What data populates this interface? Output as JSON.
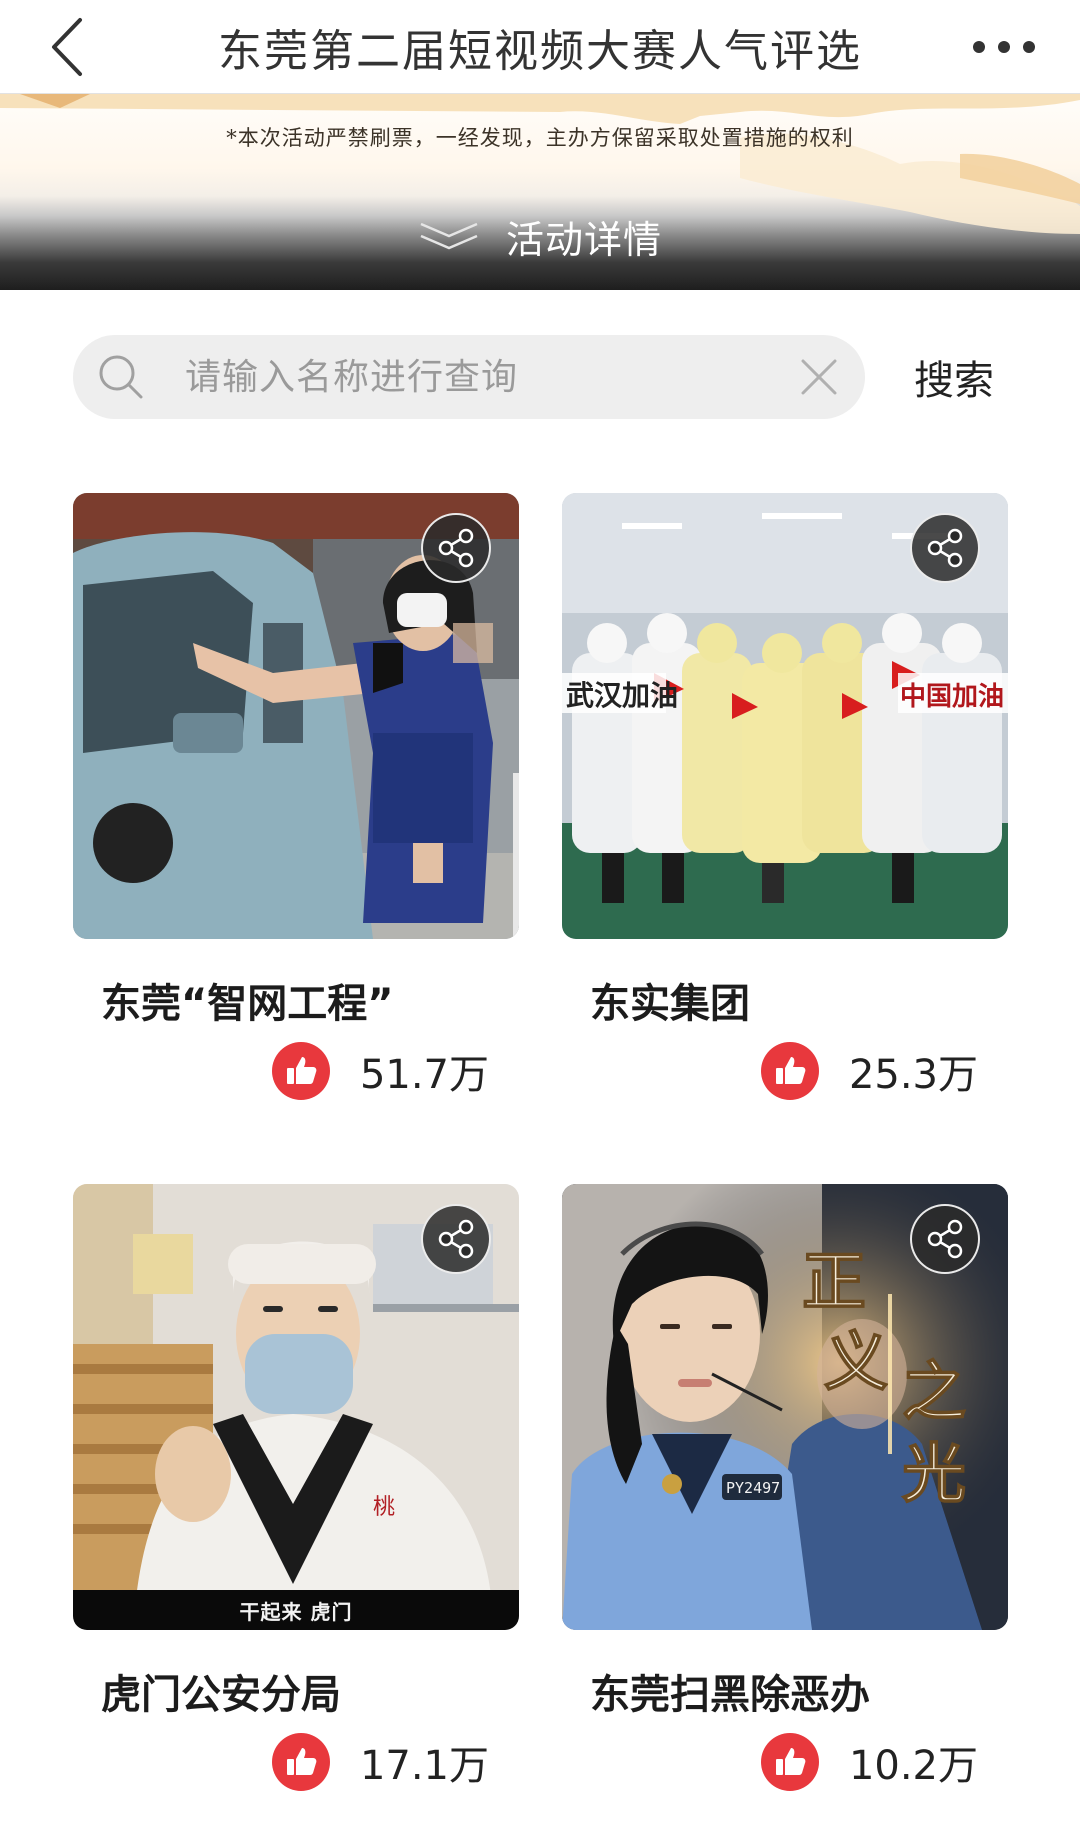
{
  "nav": {
    "title": "东莞第二届短视频大赛人气评选",
    "back_icon": "chevron-left-icon",
    "more_icon": "more-dots-icon"
  },
  "banner": {
    "notice": "*本次活动严禁刷票，一经发现，主办方保留采取处置措施的权利",
    "details_label": "活动详情",
    "toggle_icon": "double-chevron-down-icon"
  },
  "search": {
    "placeholder": "请输入名称进行查询",
    "value": "",
    "button_label": "搜索",
    "icon": "search-icon",
    "clear_icon": "clear-icon"
  },
  "entries": [
    {
      "title": "东莞“智网工程”",
      "likes": "51.7万",
      "thumbnail": "worker-temperature-check-photo"
    },
    {
      "title": "东实集团",
      "likes": "25.3万",
      "thumbnail": "factory-staff-group-photo",
      "overlay_left": "武汉加油",
      "overlay_right": "中国加油"
    },
    {
      "title": "虎门公安分局",
      "likes": "17.1万",
      "thumbnail": "masked-food-worker-photo",
      "caption": "干起来 虎门"
    },
    {
      "title": "东莞扫黑除恶办",
      "likes": "10.2万",
      "thumbnail": "police-dispatcher-photo",
      "overlay": [
        "正",
        "义",
        "之",
        "光"
      ],
      "badge_text": "PY2497"
    }
  ],
  "colors": {
    "like_red": "#e8383d",
    "share_bg": "#2a2a2a",
    "search_bg": "#eeeeee"
  }
}
